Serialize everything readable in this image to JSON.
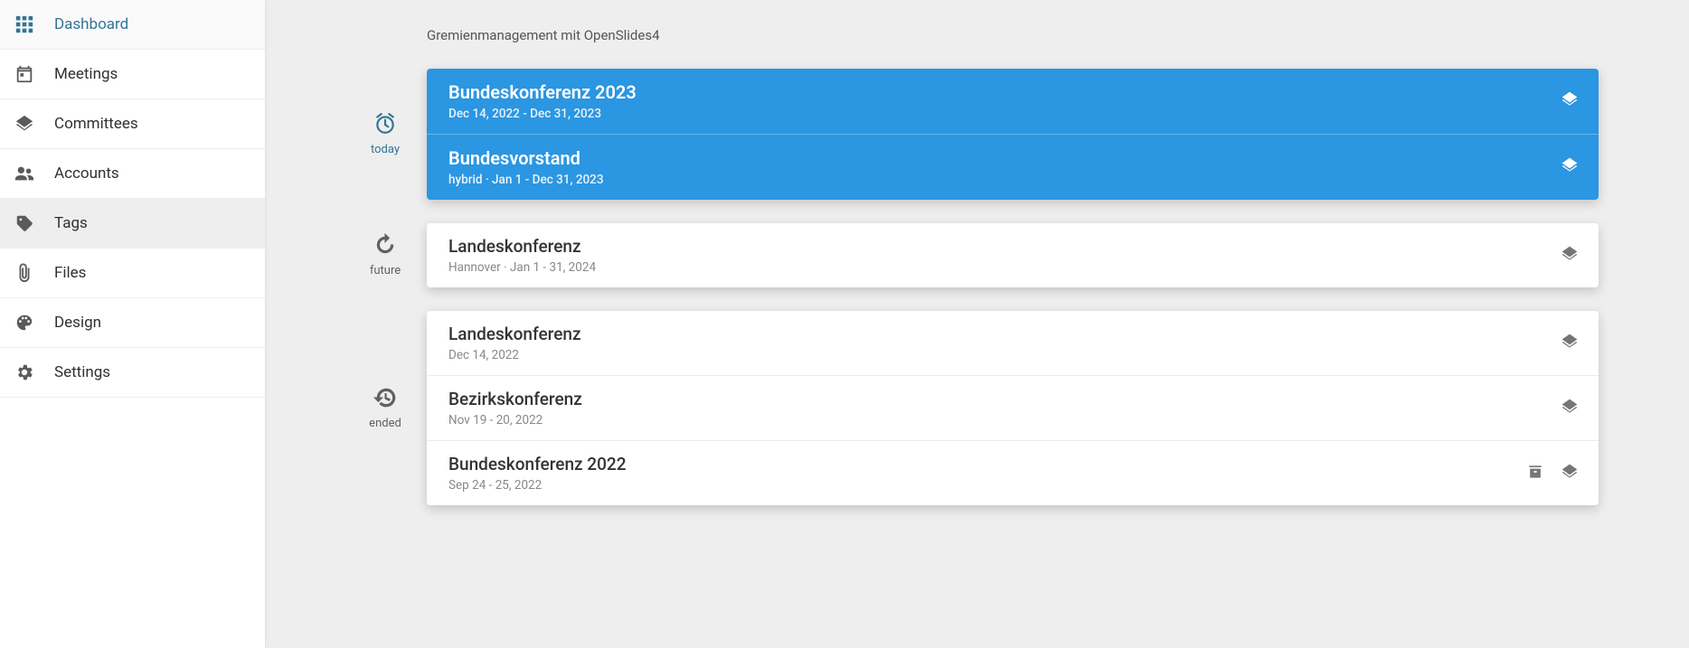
{
  "sidebar": {
    "items": [
      {
        "label": "Dashboard",
        "icon": "apps",
        "active": true,
        "selected": false
      },
      {
        "label": "Meetings",
        "icon": "event",
        "active": false,
        "selected": false
      },
      {
        "label": "Committees",
        "icon": "layers",
        "active": false,
        "selected": false
      },
      {
        "label": "Accounts",
        "icon": "group",
        "active": false,
        "selected": false
      },
      {
        "label": "Tags",
        "icon": "tag",
        "active": false,
        "selected": true
      },
      {
        "label": "Files",
        "icon": "attach",
        "active": false,
        "selected": false
      },
      {
        "label": "Design",
        "icon": "palette",
        "active": false,
        "selected": false
      },
      {
        "label": "Settings",
        "icon": "gear",
        "active": false,
        "selected": false
      }
    ]
  },
  "page_subtitle": "Gremienmanagement mit OpenSlides4",
  "groups": [
    {
      "key": "today",
      "label": "today",
      "icon": "alarm",
      "active": true,
      "meetings": [
        {
          "title": "Bundeskonferenz 2023",
          "meta": "Dec 14, 2022 - Dec 31, 2023",
          "layers": true,
          "archive": false
        },
        {
          "title": "Bundesvorstand",
          "meta": "hybrid  ·  Jan 1 - Dec 31, 2023",
          "layers": true,
          "archive": false
        }
      ]
    },
    {
      "key": "future",
      "label": "future",
      "icon": "update",
      "active": false,
      "meetings": [
        {
          "title": "Landeskonferenz",
          "meta": "Hannover  ·  Jan 1 - 31, 2024",
          "layers": true,
          "archive": false
        }
      ]
    },
    {
      "key": "ended",
      "label": "ended",
      "icon": "history",
      "active": false,
      "meetings": [
        {
          "title": "Landeskonferenz",
          "meta": "Dec 14, 2022",
          "layers": true,
          "archive": false
        },
        {
          "title": "Bezirkskonferenz",
          "meta": "Nov 19 - 20, 2022",
          "layers": true,
          "archive": false
        },
        {
          "title": "Bundeskonferenz 2022",
          "meta": "Sep 24 - 25, 2022",
          "layers": true,
          "archive": true
        }
      ]
    }
  ]
}
